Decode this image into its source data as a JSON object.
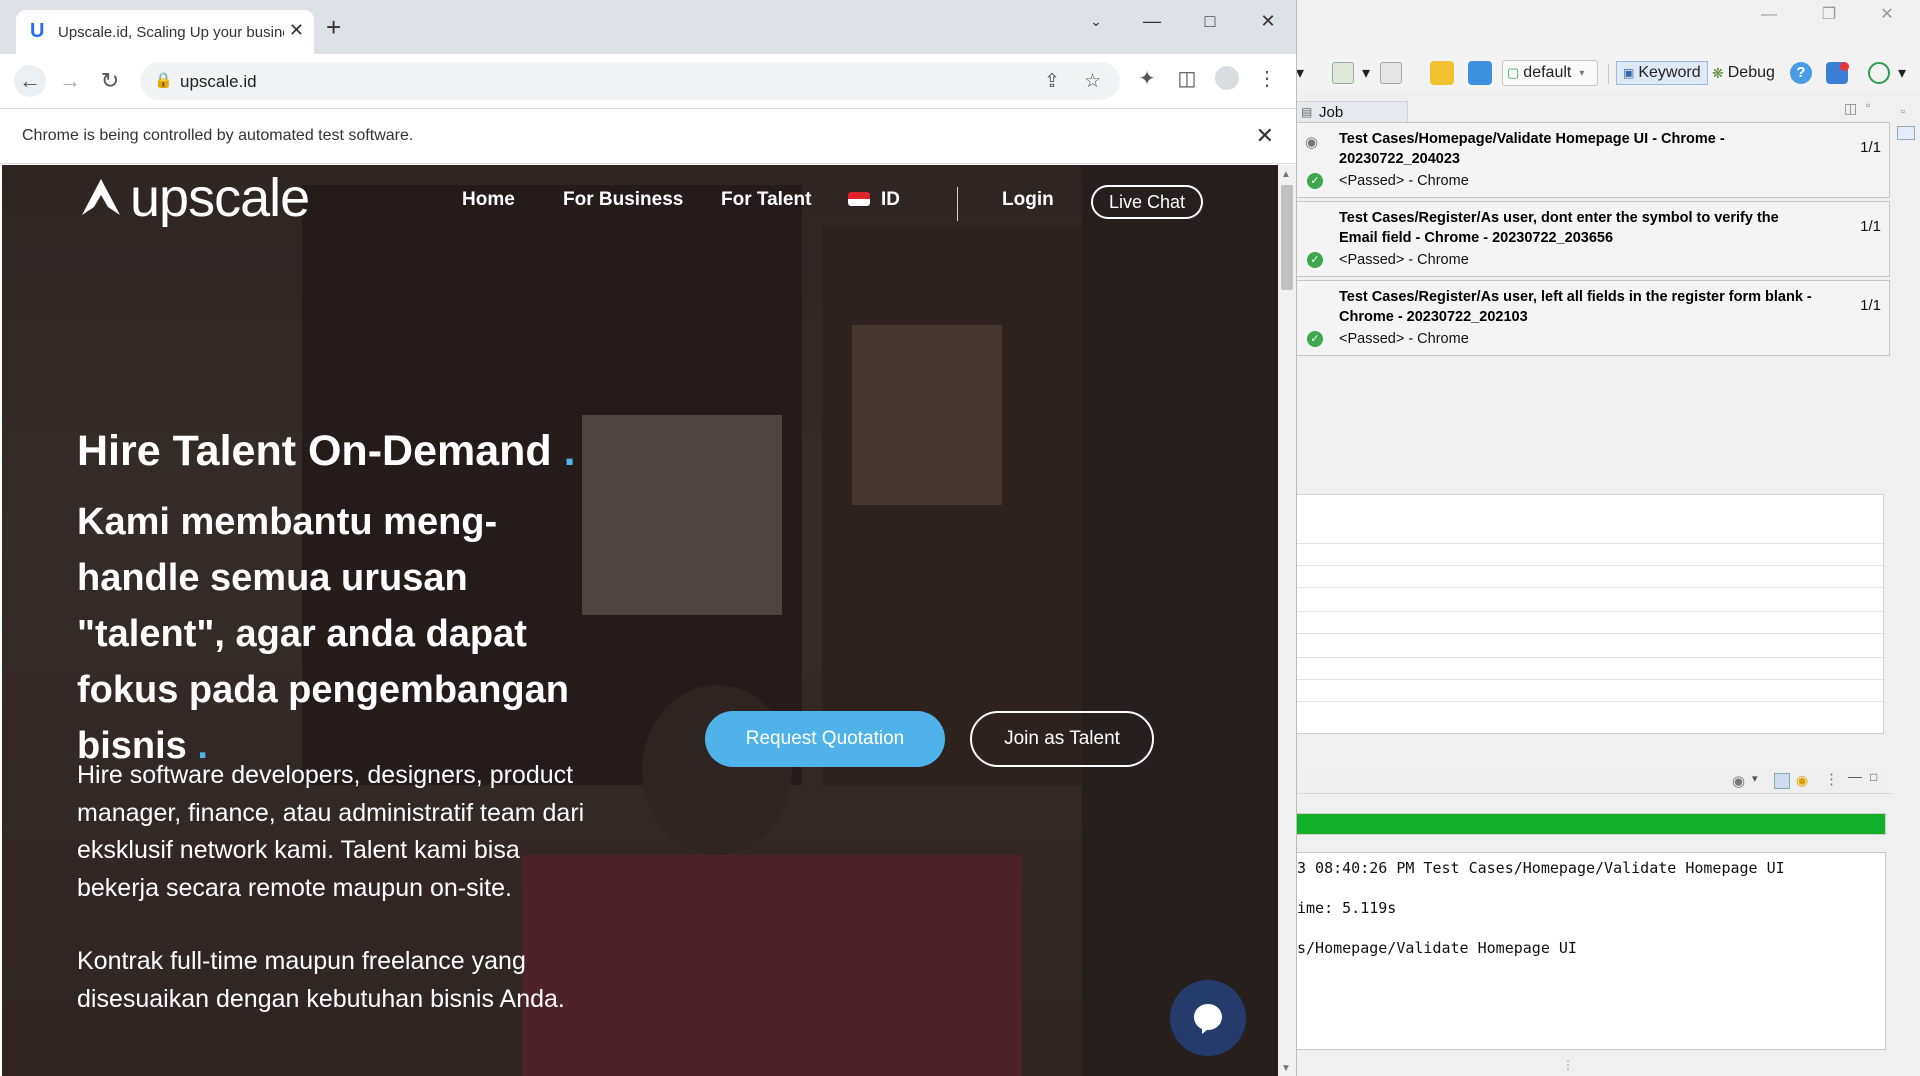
{
  "browser": {
    "tab_title": "Upscale.id, Scaling Up your business",
    "url": "upscale.id",
    "infobar_text": "Chrome is being controlled by automated test software."
  },
  "site": {
    "logo_text": "upscale",
    "nav": {
      "home": "Home",
      "for_business": "For Business",
      "for_talent": "For Talent",
      "language": "ID",
      "login": "Login",
      "live_chat": "Live Chat"
    },
    "hero": {
      "title": "Hire Talent On-Demand",
      "subtitle": "Kami membantu meng-handle semua urusan \"talent\", agar anda dapat fokus pada pengembangan bisnis",
      "paragraph1": "Hire software developers, designers, product manager, finance, atau administratif team dari eksklusif network kami. Talent kami bisa bekerja secara remote maupun on-site.",
      "paragraph2": "Kontrak full-time maupun freelance yang disesuaikan dengan kebutuhan bisnis Anda.",
      "btn_quote": "Request Quotation",
      "btn_talent": "Join as Talent"
    },
    "colors": {
      "accent": "#4fb3ea",
      "chat": "#243b6b"
    }
  },
  "ide": {
    "toolbar": {
      "profile": "default",
      "keyword": "Keyword",
      "debug": "Debug"
    },
    "job_progress": {
      "tab_label": "Job Progress",
      "jobs": [
        {
          "title": "Test Cases/Homepage/Validate Homepage UI - Chrome - 20230722_204023",
          "status": "<Passed> - Chrome",
          "count": "1/1"
        },
        {
          "title": "Test Cases/Register/As user, dont enter the symbol to verify the Email field - Chrome - 20230722_203656",
          "status": "<Passed> - Chrome",
          "count": "1/1"
        },
        {
          "title": "Test Cases/Register/As user, left all fields in the register form blank - Chrome - 20230722_202103",
          "status": "<Passed> - Chrome",
          "count": "1/1"
        }
      ]
    },
    "progress": 1.0,
    "console_lines": [
      "3 08:40:26 PM Test Cases/Homepage/Validate Homepage UI",
      "ime: 5.119s",
      "s/Homepage/Validate Homepage UI"
    ]
  }
}
